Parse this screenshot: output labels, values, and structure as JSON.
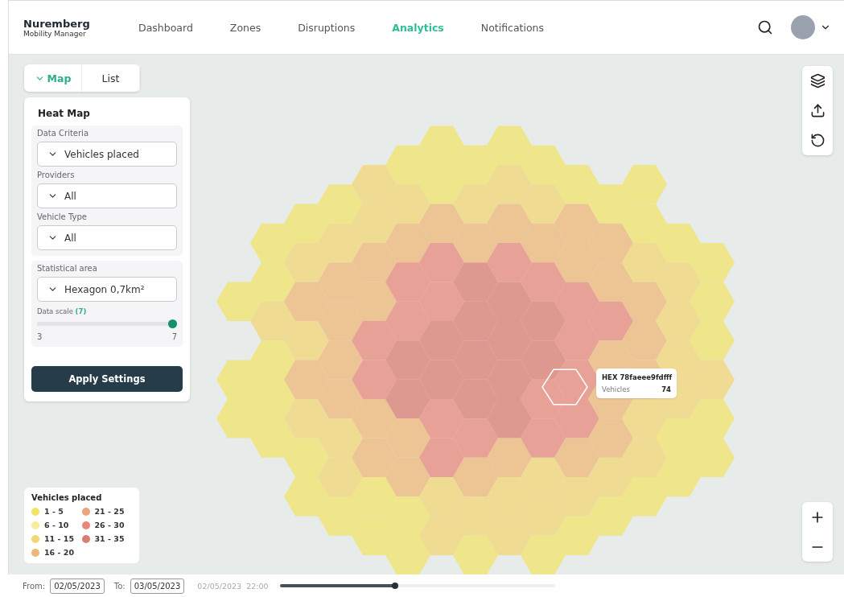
{
  "brand": {
    "title": "Nuremberg",
    "subtitle": "Mobility Manager"
  },
  "nav": [
    {
      "label": "Dashboard",
      "selected": false
    },
    {
      "label": "Zones",
      "selected": false
    },
    {
      "label": "Disruptions",
      "selected": false
    },
    {
      "label": "Analytics",
      "selected": true
    },
    {
      "label": "Notifications",
      "selected": false
    }
  ],
  "view_tabs": [
    {
      "label": "Map",
      "selected": true
    },
    {
      "label": "List",
      "selected": false
    }
  ],
  "panel": {
    "title": "Heat Map",
    "groups": [
      {
        "fields": [
          {
            "label": "Data Criteria",
            "value": "Vehicles placed"
          },
          {
            "label": "Providers",
            "value": "All"
          },
          {
            "label": "Vehicle Type",
            "value": "All"
          }
        ]
      },
      {
        "fields": [
          {
            "label": "Statistical area",
            "value": "Hexagon 0,7km²"
          }
        ],
        "scale": {
          "label": "Data scale",
          "value": "(7)",
          "level": 1,
          "min": "3",
          "max": "7"
        }
      }
    ],
    "apply_button": "Apply Settings"
  },
  "tooltip": {
    "title": "HEX 78faeee9fdfff",
    "label": "Vehicles",
    "value": "74"
  },
  "legend": {
    "title": "Vehicles placed",
    "items": [
      {
        "label": "1 - 5",
        "color": "#f2e36b"
      },
      {
        "label": "6 - 10",
        "color": "#f6ee9e"
      },
      {
        "label": "11 - 15",
        "color": "#f3d676"
      },
      {
        "label": "16 - 20",
        "color": "#efb878"
      },
      {
        "label": "21 - 25",
        "color": "#eca47f"
      },
      {
        "label": "26 - 30",
        "color": "#e8887a"
      },
      {
        "label": "31 - 35",
        "color": "#d97c72"
      }
    ]
  },
  "timeline": {
    "from_label": "From:",
    "from": "02/05/2023",
    "to_label": "To:",
    "to": "03/05/2023",
    "current": "02/05/2023  22:00",
    "level": 0.42
  }
}
